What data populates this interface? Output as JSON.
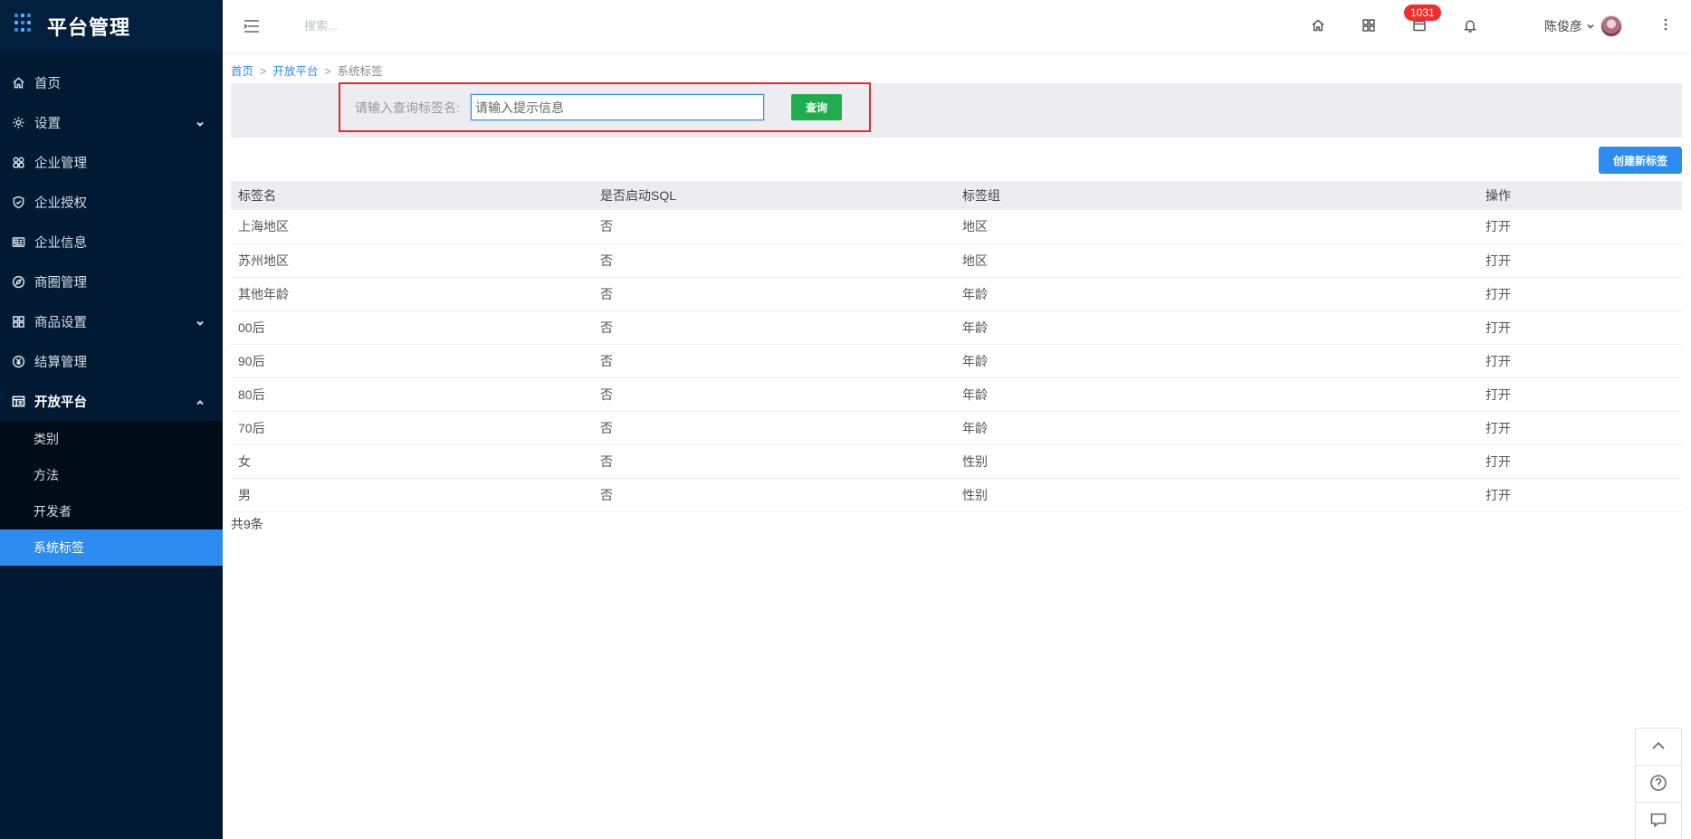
{
  "app": {
    "title": "平台管理"
  },
  "menu": [
    {
      "label": "首页",
      "icon": "home-icon"
    },
    {
      "label": "设置",
      "icon": "gear-icon",
      "expandable": true
    },
    {
      "label": "企业管理",
      "icon": "apps-icon"
    },
    {
      "label": "企业授权",
      "icon": "shield-check-icon"
    },
    {
      "label": "企业信息",
      "icon": "id-card-icon"
    },
    {
      "label": "商圈管理",
      "icon": "compass-icon"
    },
    {
      "label": "商品设置",
      "icon": "grid-icon",
      "expandable": true
    },
    {
      "label": "结算管理",
      "icon": "yen-icon"
    },
    {
      "label": "开放平台",
      "icon": "table-icon",
      "expanded": true
    }
  ],
  "submenu": [
    {
      "label": "类别"
    },
    {
      "label": "方法"
    },
    {
      "label": "开发者"
    },
    {
      "label": "系统标签",
      "active": true
    }
  ],
  "topbar": {
    "search_placeholder": "搜索...",
    "badge_count": "1031",
    "user_name": "陈俊彦"
  },
  "breadcrumb": {
    "home": "首页",
    "parent": "开放平台",
    "current": "系统标签",
    "separator": ">"
  },
  "filter": {
    "label": "请输入查询标签名:",
    "placeholder": "请输入提示信息",
    "query_button": "查询"
  },
  "actions": {
    "create_button": "创建新标签"
  },
  "table": {
    "columns": [
      "标签名",
      "是否启动SQL",
      "标签组",
      "操作"
    ],
    "rows": [
      {
        "name": "上海地区",
        "sql": "否",
        "group": "地区",
        "action": "打开"
      },
      {
        "name": "苏州地区",
        "sql": "否",
        "group": "地区",
        "action": "打开"
      },
      {
        "name": "其他年龄",
        "sql": "否",
        "group": "年龄",
        "action": "打开"
      },
      {
        "name": "00后",
        "sql": "否",
        "group": "年龄",
        "action": "打开"
      },
      {
        "name": "90后",
        "sql": "否",
        "group": "年龄",
        "action": "打开"
      },
      {
        "name": "80后",
        "sql": "否",
        "group": "年龄",
        "action": "打开"
      },
      {
        "name": "70后",
        "sql": "否",
        "group": "年龄",
        "action": "打开"
      },
      {
        "name": "女",
        "sql": "否",
        "group": "性别",
        "action": "打开"
      },
      {
        "name": "男",
        "sql": "否",
        "group": "性别",
        "action": "打开"
      }
    ],
    "total": "共9条"
  },
  "colors": {
    "sidebar_bg": "#011a33",
    "accent": "#2d8cf0",
    "query_button": "#1fad4d",
    "badge": "#f02c2c",
    "highlight_frame": "#e32b2b"
  }
}
